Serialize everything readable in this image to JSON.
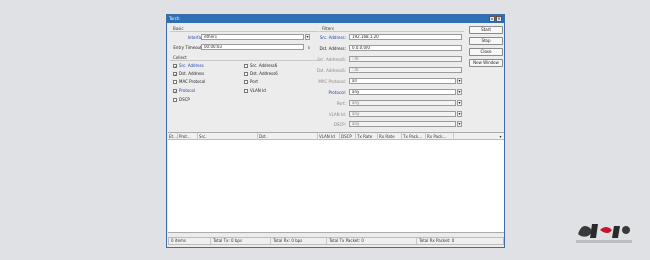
{
  "window": {
    "title": "Torch"
  },
  "basic": {
    "section": "Basic",
    "interface_label": "Interface:",
    "interface_value": "ether1",
    "entry_timeout_label": "Entry Timeout:",
    "entry_timeout_value": "00:00:03",
    "entry_timeout_unit": "s"
  },
  "collect": {
    "section": "Collect",
    "items": [
      {
        "label": "Src. Address",
        "checked": true
      },
      {
        "label": "Dst. Address",
        "checked": true
      },
      {
        "label": "MAC Protocol",
        "checked": false
      },
      {
        "label": "Protocol",
        "checked": true
      },
      {
        "label": "DSCP",
        "checked": false
      },
      {
        "label": "Src. Address6",
        "checked": false
      },
      {
        "label": "Dst. Address6",
        "checked": false
      },
      {
        "label": "Port",
        "checked": false
      },
      {
        "label": "VLAN Id",
        "checked": false
      }
    ]
  },
  "filters": {
    "section": "Filters",
    "rows": [
      {
        "label": "Src. Address:",
        "value": "192.168.1.20"
      },
      {
        "label": "Dst. Address:",
        "value": "0.0.0.0/0"
      },
      {
        "label": "Src. Address6:",
        "value": "::/0"
      },
      {
        "label": "Dst. Address6:",
        "value": "::/0"
      },
      {
        "label": "MAC Protocol:",
        "value": "all"
      },
      {
        "label": "Protocol:",
        "value": "any"
      },
      {
        "label": "Port:",
        "value": "any"
      },
      {
        "label": "VLAN Id:",
        "value": "any"
      },
      {
        "label": "DSCP:",
        "value": "any"
      }
    ]
  },
  "buttons": {
    "start": "Start",
    "stop": "Stop",
    "close": "Close",
    "new_window": "New Window"
  },
  "table": {
    "columns": [
      "Et...",
      "Prot...",
      "Src.",
      "Dst.",
      "VLAN Id",
      "DSCP",
      "Tx Rate",
      "Rx Rate",
      "Tx Pack...",
      "Rx Pack..."
    ]
  },
  "status": {
    "items": "0 items",
    "total_tx": "Total Tx: 0 bps",
    "total_rx": "Total Rx: 0 bps",
    "total_tx_packet": "Total Tx Packet: 0",
    "total_rx_packet": "Total Rx Packet: 0"
  }
}
